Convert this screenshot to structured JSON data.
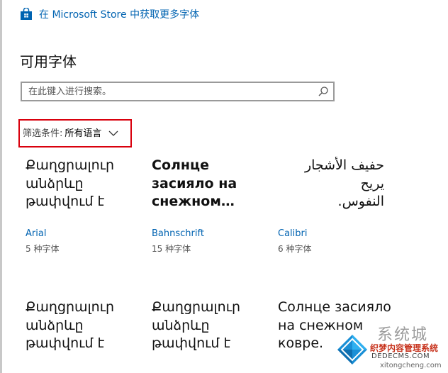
{
  "store_link": {
    "text": "在 Microsoft Store 中获取更多字体",
    "icon": "store-bag-icon"
  },
  "section_title": "可用字体",
  "search": {
    "placeholder": "在此键入进行搜索。",
    "value": "",
    "icon": "search-icon"
  },
  "filter": {
    "label": "筛选条件:",
    "value": "所有语言",
    "icon": "chevron-down-icon"
  },
  "fonts": [
    {
      "preview": "Քաղցրալուր\nանձրևը\nթափվում է\nտանիքից:",
      "name": "Arial",
      "count": "5 种字体"
    },
    {
      "preview": "Солнце\nзасияло на\nснежном…",
      "name": "Bahnschrift",
      "count": "15 种字体"
    },
    {
      "preview": "حفيف الأشجار يريح\nالنفوس.",
      "name": "Calibri",
      "count": "6 种字体"
    },
    {
      "preview": "Քաղցրալուր\nանձրևը\nթափվում է\nտանիքից:"
    },
    {
      "preview": "Քաղցրալուր\nանձրևը\nթափվում է\nտանիքից:"
    },
    {
      "preview": "Солнце засияло\nна снежном\nковре."
    }
  ],
  "watermark": {
    "text_top": "系统城",
    "text_cn": "织梦内容管理系统",
    "text_url1": "DEDECMS.COM",
    "text_url2": "xitongcheng.com"
  },
  "colors": {
    "link": "#0063b1",
    "highlight_border": "#d9000d",
    "search_border": "#9a9a9a",
    "watermark_red": "#c7321c"
  }
}
